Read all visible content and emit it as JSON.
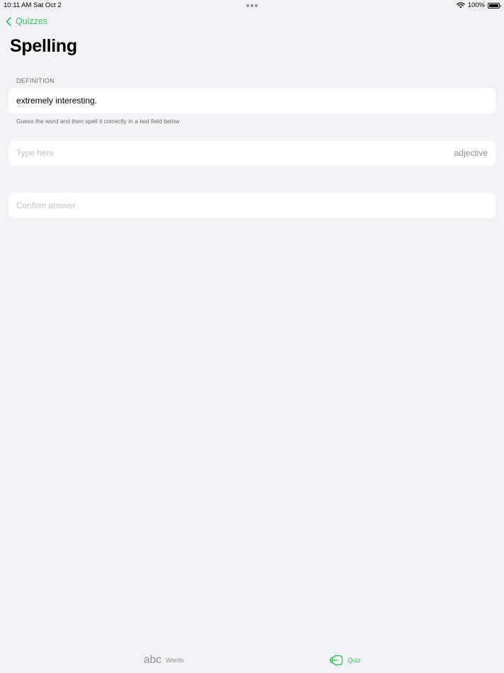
{
  "status_bar": {
    "time": "10:11 AM",
    "date": "Sat Oct 2",
    "battery_percent": "100%",
    "battery_level": 1.0
  },
  "nav": {
    "back_label": "Quizzes",
    "title": "Spelling"
  },
  "definition_section": {
    "header": "DEFINITION",
    "text": "extremely interesting.",
    "footer": "Guess the word and then spell it correctly in a text field below"
  },
  "answer_field": {
    "placeholder": "Type here",
    "value": "",
    "part_of_speech": "adjective"
  },
  "confirm_button": {
    "label": "Confirm answer"
  },
  "tab_bar": {
    "tabs": [
      {
        "label": "Words",
        "icon": "abc-icon",
        "icon_glyph": "abc",
        "selected": false
      },
      {
        "label": "Quiz",
        "icon": "quiz-icon",
        "selected": true
      }
    ]
  },
  "colors": {
    "accent": "#34c759",
    "background": "#f2f2f7",
    "card": "#ffffff",
    "secondary_text": "#8e8e93",
    "placeholder": "#c4c4c6"
  }
}
